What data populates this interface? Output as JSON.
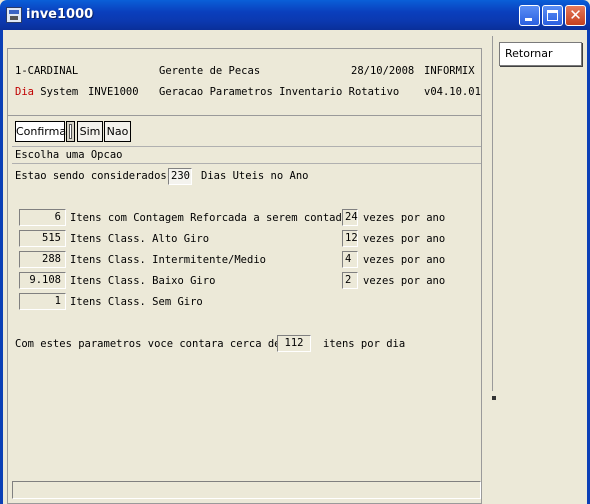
{
  "window": {
    "title": "inve1000"
  },
  "header": {
    "company": "1-CARDINAL",
    "module": "Gerente de Pecas",
    "date": "28/10/2008",
    "db": "INFORMIX",
    "system_prefix": "Dia",
    "system_word": " System",
    "program": "INVE1000",
    "description": "Geracao Parametros Inventario Rotativo",
    "version": "v04.10.01"
  },
  "menu": {
    "items": [
      "Confirma",
      "Sim",
      "Nao"
    ],
    "prompt": "Escolha uma Opcao"
  },
  "form": {
    "days_label": "Estao sendo considerados",
    "days_value": "230",
    "days_suffix": "Dias Uteis no Ano",
    "rows": [
      {
        "count": "6",
        "label": "Itens com Contagem Reforcada a serem contados",
        "times": "24",
        "times_suffix": "vezes por ano"
      },
      {
        "count": "515",
        "label": "Itens Class. Alto Giro",
        "times": "12",
        "times_suffix": "vezes por ano"
      },
      {
        "count": "288",
        "label": "Itens Class. Intermitente/Medio",
        "times": "4",
        "times_suffix": "vezes por ano"
      },
      {
        "count": "9.108",
        "label": "Itens Class. Baixo Giro",
        "times": "2",
        "times_suffix": "vezes por ano"
      },
      {
        "count": "1",
        "label": "Itens Class. Sem Giro"
      }
    ],
    "summary_label": "Com estes parametros voce contara cerca de",
    "summary_value": "112",
    "summary_suffix": "itens por dia"
  },
  "side": {
    "return_label": "Retornar"
  }
}
